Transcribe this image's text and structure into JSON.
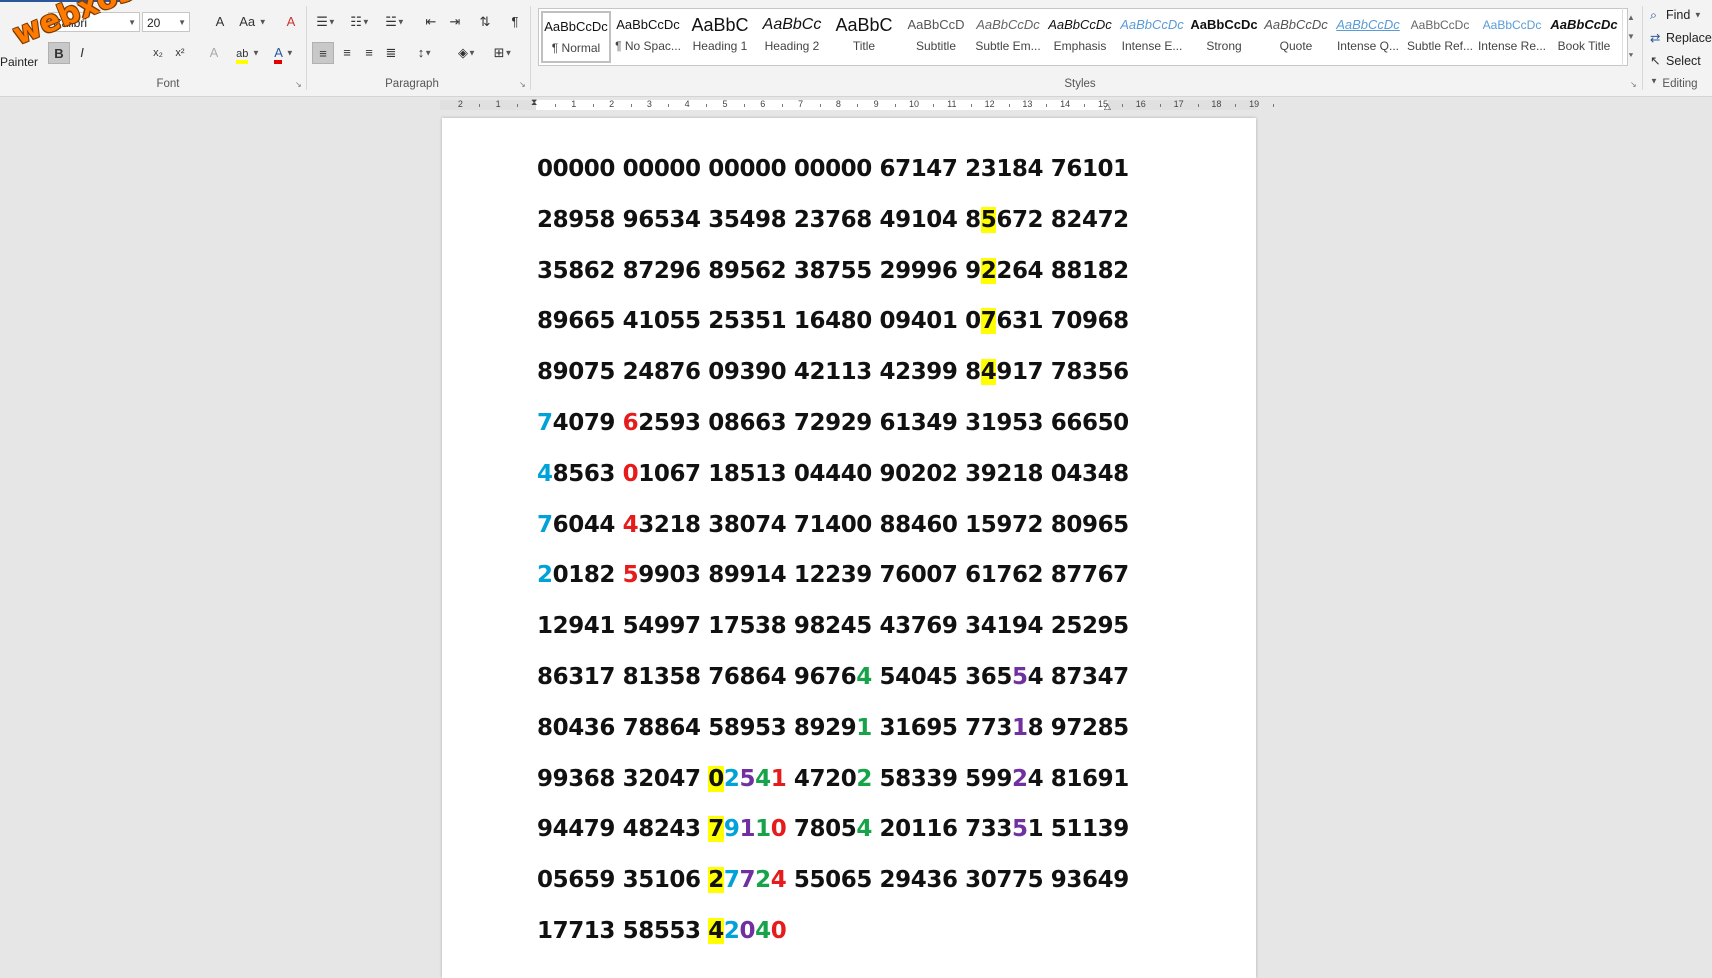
{
  "watermark": "webxoso.net",
  "ribbon": {
    "clipboard_fragment": "Painter",
    "font": {
      "label": "Font",
      "family": "Calibri",
      "size": "20",
      "grow_icon": "A",
      "case_label": "Aa",
      "bold": "B",
      "italic": "I",
      "subscript": "x₂",
      "superscript": "x²",
      "effects_icon": "A",
      "highlight_icon": "ab",
      "color_icon": "A",
      "clear_icon": "A"
    },
    "paragraph": {
      "label": "Paragraph",
      "pilcrow": "¶"
    },
    "styles": {
      "label": "Styles",
      "items": [
        {
          "preview": "AaBbCcDc",
          "name": "¶ Normal"
        },
        {
          "preview": "AaBbCcDc",
          "name": "¶ No Spac..."
        },
        {
          "preview": "AaBbC",
          "name": "Heading 1"
        },
        {
          "preview": "AaBbCc",
          "name": "Heading 2"
        },
        {
          "preview": "AaBbC",
          "name": "Title"
        },
        {
          "preview": "AaBbCcD",
          "name": "Subtitle"
        },
        {
          "preview": "AaBbCcDc",
          "name": "Subtle Em..."
        },
        {
          "preview": "AaBbCcDc",
          "name": "Emphasis"
        },
        {
          "preview": "AaBbCcDc",
          "name": "Intense E..."
        },
        {
          "preview": "AaBbCcDc",
          "name": "Strong"
        },
        {
          "preview": "AaBbCcDc",
          "name": "Quote"
        },
        {
          "preview": "AaBbCcDc",
          "name": "Intense Q..."
        },
        {
          "preview": "AaBbCcDc",
          "name": "Subtle Ref..."
        },
        {
          "preview": "AaBbCcDc",
          "name": "Intense Re..."
        },
        {
          "preview": "AaBbCcDc",
          "name": "Book Title"
        }
      ]
    },
    "editing": {
      "label": "Editing",
      "find": "Find",
      "replace": "Replace",
      "select": "Select"
    }
  },
  "ruler": {
    "left_numbers": [
      "2",
      "1"
    ],
    "right_numbers": [
      "1",
      "2",
      "3",
      "4",
      "5",
      "6",
      "7",
      "8",
      "9",
      "10",
      "11",
      "12",
      "13",
      "14",
      "15",
      "16",
      "17",
      "18",
      "19"
    ]
  },
  "document": {
    "rows": [
      [
        [
          "00000 00000 00000 00000 67147 23184 76101",
          ""
        ]
      ],
      [
        [
          "28958 96534 35498 23768 49104 8",
          ""
        ],
        [
          "5",
          "hl"
        ],
        [
          "672 82472",
          ""
        ]
      ],
      [
        [
          "35862 87296 89562 38755 29996 9",
          ""
        ],
        [
          "2",
          "hl"
        ],
        [
          "264 88182",
          ""
        ]
      ],
      [
        [
          "89665 41055 25351 16480 09401 0",
          ""
        ],
        [
          "7",
          "hl"
        ],
        [
          "631 70968",
          ""
        ]
      ],
      [
        [
          "89075 24876 09390 42113 42399 8",
          ""
        ],
        [
          "4",
          "hl"
        ],
        [
          "917 78356",
          ""
        ]
      ],
      [
        [
          "7",
          "c-blue"
        ],
        [
          "4079 ",
          ""
        ],
        [
          "6",
          "c-red"
        ],
        [
          "2593 08663 72929 61349 31953 66650",
          ""
        ]
      ],
      [
        [
          "4",
          "c-blue"
        ],
        [
          "8563 ",
          ""
        ],
        [
          "0",
          "c-red"
        ],
        [
          "1067 18513 04440 90202 39218 04348",
          ""
        ]
      ],
      [
        [
          "7",
          "c-blue"
        ],
        [
          "6044 ",
          ""
        ],
        [
          "4",
          "c-red"
        ],
        [
          "3218 38074 71400 88460 15972 80965",
          ""
        ]
      ],
      [
        [
          "2",
          "c-blue"
        ],
        [
          "0182 ",
          ""
        ],
        [
          "5",
          "c-red"
        ],
        [
          "9903 89914 12239 76007 61762 87767",
          ""
        ]
      ],
      [
        [
          "12941 54997 17538 98245 43769 34194 25295",
          ""
        ]
      ],
      [
        [
          "86317 81358 76864 9676",
          ""
        ],
        [
          "4",
          "c-green"
        ],
        [
          " 54045 365",
          ""
        ],
        [
          "5",
          "c-purple"
        ],
        [
          "4 87347",
          ""
        ]
      ],
      [
        [
          "80436 78864 58953 8929",
          ""
        ],
        [
          "1",
          "c-green"
        ],
        [
          " 31695 773",
          ""
        ],
        [
          "1",
          "c-purple"
        ],
        [
          "8 97285",
          ""
        ]
      ],
      [
        [
          "99368 32047 ",
          ""
        ],
        [
          "0",
          "hl"
        ],
        [
          "2",
          "c-blue"
        ],
        [
          "5",
          "c-purple"
        ],
        [
          "4",
          "c-green"
        ],
        [
          "1",
          "c-red"
        ],
        [
          " 4720",
          ""
        ],
        [
          "2",
          "c-green"
        ],
        [
          " 58339 599",
          ""
        ],
        [
          "2",
          "c-purple"
        ],
        [
          "4 81691",
          ""
        ]
      ],
      [
        [
          "94479 48243 ",
          ""
        ],
        [
          "7",
          "hl"
        ],
        [
          "9",
          "c-blue"
        ],
        [
          "1",
          "c-purple"
        ],
        [
          "1",
          "c-green"
        ],
        [
          "0",
          "c-red"
        ],
        [
          " 7805",
          ""
        ],
        [
          "4",
          "c-green"
        ],
        [
          " 20116 733",
          ""
        ],
        [
          "5",
          "c-purple"
        ],
        [
          "1 51139",
          ""
        ]
      ],
      [
        [
          "05659 35106 ",
          ""
        ],
        [
          "2",
          "hl"
        ],
        [
          "7",
          "c-blue"
        ],
        [
          "7",
          "c-purple"
        ],
        [
          "2",
          "c-green"
        ],
        [
          "4",
          "c-red"
        ],
        [
          " 55065 29436 30775 93649",
          ""
        ]
      ],
      [
        [
          "17713 58553 ",
          ""
        ],
        [
          "4",
          "hl"
        ],
        [
          "2",
          "c-blue"
        ],
        [
          "0",
          "c-purple"
        ],
        [
          "4",
          "c-green"
        ],
        [
          "0",
          "c-red"
        ]
      ]
    ]
  }
}
